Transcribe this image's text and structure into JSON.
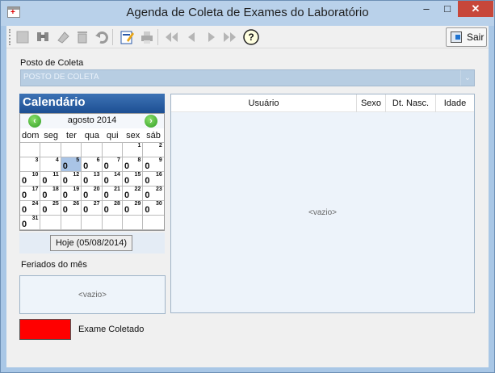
{
  "window": {
    "title": "Agenda de Coleta de Exames do Laboratório",
    "controls": {
      "minimize": "–",
      "maximize": "□",
      "close": "✕"
    }
  },
  "toolbar": {
    "sair_label": "Sair",
    "tools": [
      "new-icon",
      "find-icon",
      "eraser-icon",
      "trash-icon",
      "undo-icon",
      "edit-icon",
      "print-icon",
      "first-icon",
      "prev-icon",
      "next-icon",
      "last-icon",
      "help-icon"
    ]
  },
  "posto": {
    "label": "Posto de Coleta",
    "value": "POSTO DE COLETA"
  },
  "calendar": {
    "header": "Calendário",
    "month_label": "agosto 2014",
    "weekdays": [
      "dom",
      "seg",
      "ter",
      "qua",
      "qui",
      "sex",
      "sáb"
    ],
    "today_button": "Hoje (05/08/2014)",
    "today_day": 5,
    "weeks": [
      [
        null,
        null,
        null,
        null,
        null,
        {
          "d": "1",
          "c": ""
        },
        {
          "d": "2",
          "c": ""
        }
      ],
      [
        {
          "d": "3",
          "c": ""
        },
        {
          "d": "4",
          "c": ""
        },
        {
          "d": "5",
          "c": "0"
        },
        {
          "d": "6",
          "c": "0"
        },
        {
          "d": "7",
          "c": "0"
        },
        {
          "d": "8",
          "c": "0"
        },
        {
          "d": "9",
          "c": "0"
        }
      ],
      [
        {
          "d": "10",
          "c": "0"
        },
        {
          "d": "11",
          "c": "0"
        },
        {
          "d": "12",
          "c": "0"
        },
        {
          "d": "13",
          "c": "0"
        },
        {
          "d": "14",
          "c": "0"
        },
        {
          "d": "15",
          "c": "0"
        },
        {
          "d": "16",
          "c": "0"
        }
      ],
      [
        {
          "d": "17",
          "c": "0"
        },
        {
          "d": "18",
          "c": "0"
        },
        {
          "d": "19",
          "c": "0"
        },
        {
          "d": "20",
          "c": "0"
        },
        {
          "d": "21",
          "c": "0"
        },
        {
          "d": "22",
          "c": "0"
        },
        {
          "d": "23",
          "c": "0"
        }
      ],
      [
        {
          "d": "24",
          "c": "0"
        },
        {
          "d": "25",
          "c": "0"
        },
        {
          "d": "26",
          "c": "0"
        },
        {
          "d": "27",
          "c": "0"
        },
        {
          "d": "28",
          "c": "0"
        },
        {
          "d": "29",
          "c": "0"
        },
        {
          "d": "30",
          "c": "0"
        }
      ],
      [
        {
          "d": "31",
          "c": "0"
        },
        null,
        null,
        null,
        null,
        null,
        null
      ]
    ]
  },
  "feriados": {
    "label": "Feriados do mês",
    "empty_text": "<vazio>"
  },
  "grid": {
    "columns": [
      "Usuário",
      "Sexo",
      "Dt. Nasc.",
      "Idade"
    ],
    "empty_text": "<vazio>"
  },
  "legend": {
    "color": "#ff0000",
    "label": "Exame Coletado"
  }
}
